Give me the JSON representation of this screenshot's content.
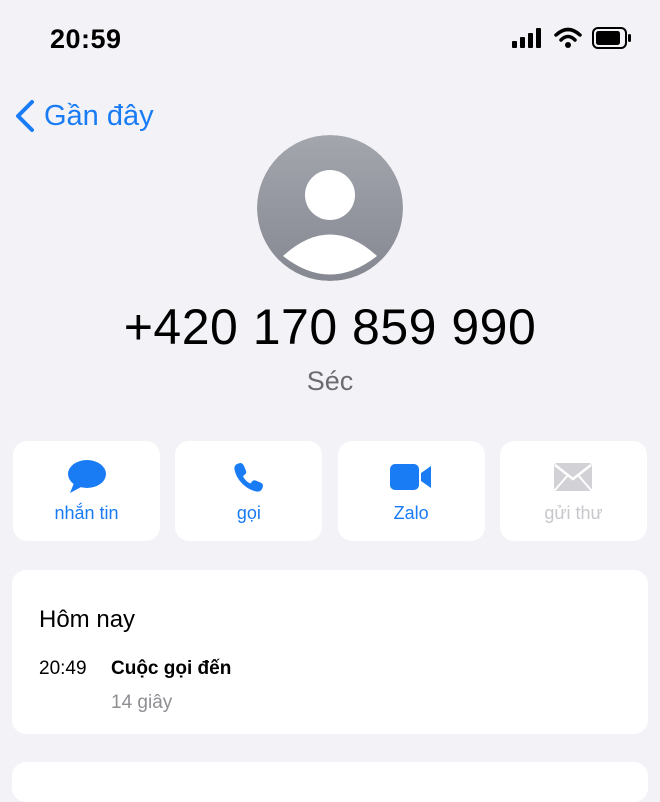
{
  "status_bar": {
    "time": "20:59",
    "icons": [
      "signal-icon",
      "wifi-icon",
      "battery-icon"
    ]
  },
  "nav": {
    "back_label": "Gần đây",
    "back_icon": "chevron-left-icon"
  },
  "contact": {
    "phone_number": "+420 170 859 990",
    "country": "Séc",
    "avatar_icon": "person-placeholder-icon"
  },
  "actions": [
    {
      "label": "nhắn tin",
      "icon": "message-bubble-icon",
      "enabled": true
    },
    {
      "label": "gọi",
      "icon": "phone-icon",
      "enabled": true
    },
    {
      "label": "Zalo",
      "icon": "video-camera-icon",
      "enabled": true
    },
    {
      "label": "gửi thư",
      "icon": "mail-icon",
      "enabled": false
    }
  ],
  "history": {
    "heading": "Hôm nay",
    "entries": [
      {
        "time": "20:49",
        "type": "Cuộc gọi đến",
        "duration": "14 giây"
      }
    ]
  },
  "colors": {
    "accent": "#1a7cf5",
    "background": "#f2f2f7",
    "secondary_text": "#8e8e93",
    "disabled": "#c7c7cc"
  }
}
